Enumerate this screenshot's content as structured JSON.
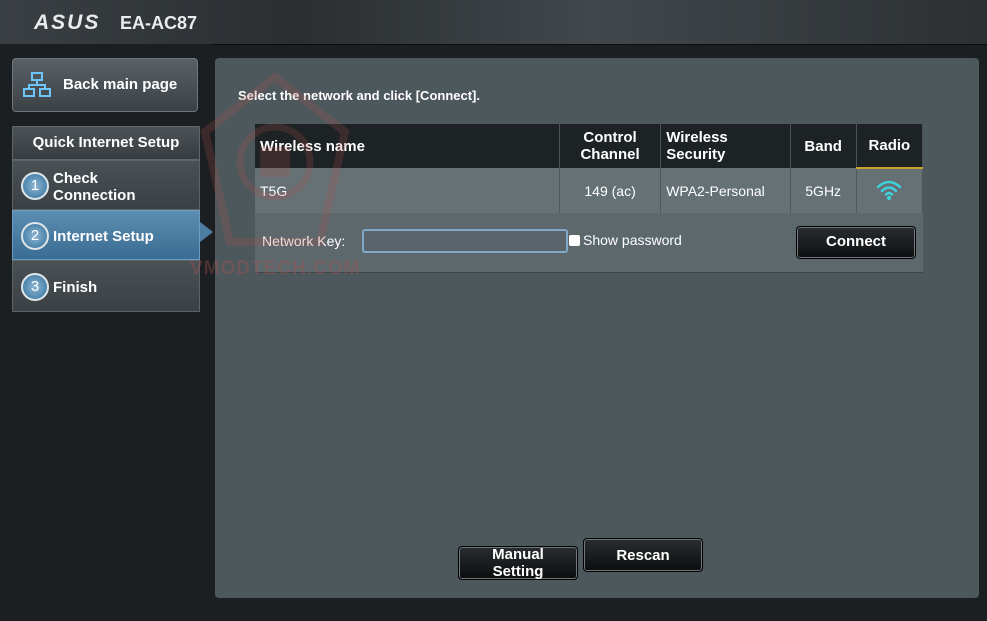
{
  "header": {
    "brand": "ASUS",
    "model": "EA-AC87"
  },
  "sidebar": {
    "back_label": "Back main page",
    "section_title": "Quick Internet Setup",
    "steps": [
      {
        "num": "1",
        "label": "Check Connection"
      },
      {
        "num": "2",
        "label": "Internet Setup"
      },
      {
        "num": "3",
        "label": "Finish"
      }
    ]
  },
  "main": {
    "instruction": "Select the network and click [Connect].",
    "columns": [
      "Wireless name",
      "Control Channel",
      "Wireless Security",
      "Band",
      "Radio"
    ],
    "network": {
      "name": "T5G",
      "channel": "149 (ac)",
      "security": "WPA2-Personal",
      "band": "5GHz",
      "radio_icon": "wifi-signal-icon"
    },
    "key_label": "Network Key:",
    "key_value": "",
    "show_password_label": "Show password",
    "connect_label": "Connect",
    "manual_label": "Manual Setting",
    "rescan_label": "Rescan"
  },
  "watermark": "VMODTECH.COM",
  "colors": {
    "accent": "#4b7ca2",
    "panel": "#4d585c",
    "wifi": "#3fd3e0"
  }
}
